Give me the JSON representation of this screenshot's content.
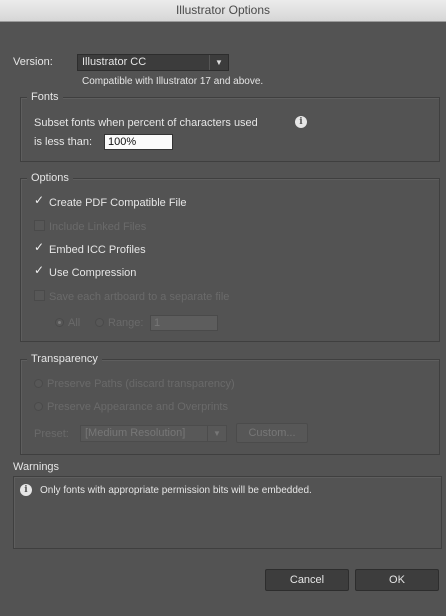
{
  "window": {
    "title": "Illustrator Options"
  },
  "version": {
    "label": "Version:",
    "selected": "Illustrator CC",
    "note": "Compatible with Illustrator 17 and above."
  },
  "fonts": {
    "legend": "Fonts",
    "line1": "Subset fonts when percent of characters used",
    "line2": "is less than:",
    "value": "100%"
  },
  "options": {
    "legend": "Options",
    "create_pdf": {
      "label": "Create PDF Compatible File",
      "checked": true,
      "enabled": true
    },
    "include_linked": {
      "label": "Include Linked Files",
      "checked": false,
      "enabled": false
    },
    "embed_icc": {
      "label": "Embed ICC Profiles",
      "checked": true,
      "enabled": true
    },
    "use_compression": {
      "label": "Use Compression",
      "checked": true,
      "enabled": true
    },
    "save_artboards": {
      "label": "Save each artboard to a separate file",
      "checked": false,
      "enabled": false
    },
    "radio_all": "All",
    "radio_range": "Range:",
    "range_value": "1"
  },
  "transparency": {
    "legend": "Transparency",
    "preserve_paths": "Preserve Paths (discard transparency)",
    "preserve_appearance": "Preserve Appearance and Overprints",
    "preset_label": "Preset:",
    "preset_value": "[Medium Resolution]",
    "custom_button": "Custom..."
  },
  "warnings": {
    "heading": "Warnings",
    "message": "Only fonts with appropriate permission bits will be embedded."
  },
  "buttons": {
    "cancel": "Cancel",
    "ok": "OK"
  },
  "colors": {
    "dialog_bg": "#535353",
    "text": "#e6e6e6",
    "disabled_text": "#6a6a6a"
  }
}
